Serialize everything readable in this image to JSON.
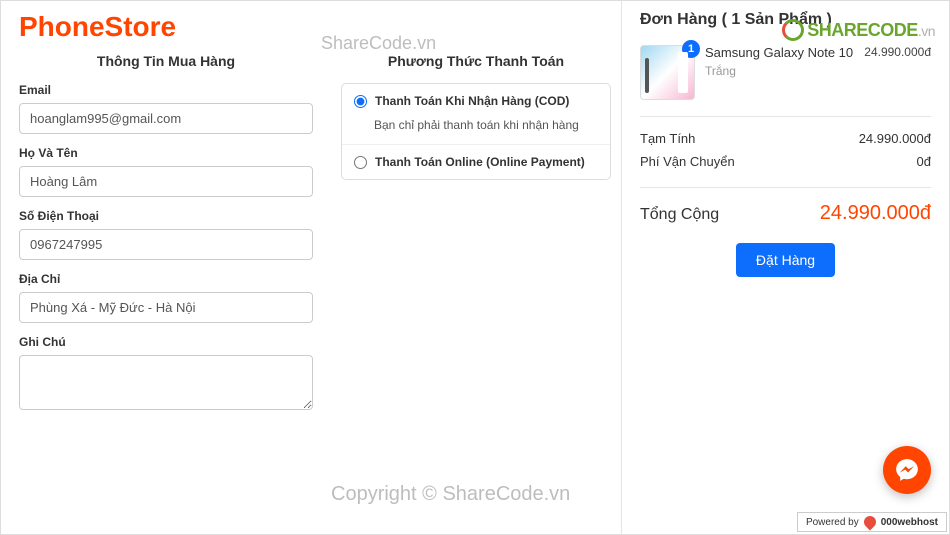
{
  "brand": "PhoneStore",
  "watermark_top": "ShareCode.vn",
  "watermark_bottom": "Copyright © ShareCode.vn",
  "sharecode_logo": {
    "part1": "SHARE",
    "part2": "CODE",
    "suffix": ".vn"
  },
  "customer_section_title": "Thông Tin Mua Hàng",
  "payment_section_title": "Phương Thức Thanh Toán",
  "form": {
    "email_label": "Email",
    "email_value": "hoanglam995@gmail.com",
    "name_label": "Họ Và Tên",
    "name_value": "Hoàng Lâm",
    "phone_label": "Số Điện Thoại",
    "phone_value": "0967247995",
    "address_label": "Địa Chỉ",
    "address_value": "Phùng Xá - Mỹ Đức - Hà Nội",
    "note_label": "Ghi Chú",
    "note_value": ""
  },
  "payment": {
    "cod_label": "Thanh Toán Khi Nhận Hàng (COD)",
    "cod_desc": "Bạn chỉ phải thanh toán khi nhận hàng",
    "online_label": "Thanh Toán Online (Online Payment)"
  },
  "order": {
    "title": "Đơn Hàng ( 1 Sản Phẩm )",
    "item": {
      "qty": "1",
      "name": "Samsung Galaxy Note 10",
      "variant": "Trắng",
      "price": "24.990.000đ"
    },
    "subtotal_label": "Tạm Tính",
    "subtotal_value": "24.990.000đ",
    "shipping_label": "Phí Vận Chuyển",
    "shipping_value": "0đ",
    "total_label": "Tổng Cộng",
    "total_value": "24.990.000đ",
    "submit_label": "Đặt Hàng"
  },
  "powered_by": {
    "prefix": "Powered by",
    "host": "000webhost"
  }
}
